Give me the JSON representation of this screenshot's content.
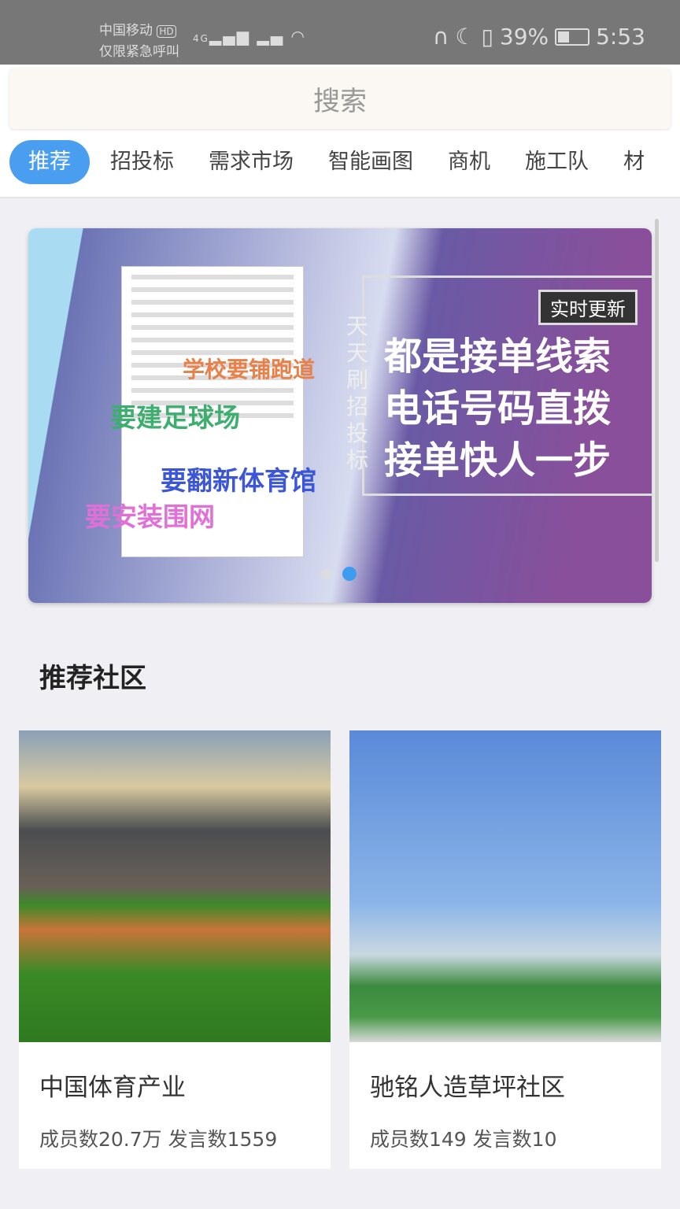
{
  "status_bar": {
    "carrier": "中国移动",
    "hd": "HD",
    "emergency": "仅限紧急呼叫",
    "network": "4G",
    "battery": "39%",
    "time": "5:53"
  },
  "search": {
    "placeholder": "搜索"
  },
  "tabs": [
    {
      "label": "推荐",
      "active": true
    },
    {
      "label": "招投标"
    },
    {
      "label": "需求市场"
    },
    {
      "label": "智能画图"
    },
    {
      "label": "商机"
    },
    {
      "label": "施工队"
    },
    {
      "label": "材"
    }
  ],
  "banner": {
    "overlay": [
      "学校要铺跑道",
      "要建足球场",
      "要翻新体育馆",
      "要安装围网"
    ],
    "vertical": "天天刷招投标",
    "tag": "实时更新",
    "headline": [
      "都是接单线索",
      "电话号码直拨",
      "接单快人一步"
    ],
    "active_slide": 2,
    "slides": 2
  },
  "section_title": "推荐社区",
  "communities": [
    {
      "name": "中国体育产业",
      "stats": "成员数20.7万 发言数1559"
    },
    {
      "name": "驰铭人造草坪社区",
      "stats": "成员数149 发言数10"
    }
  ],
  "colors": {
    "accent": "#4a9ef0"
  }
}
